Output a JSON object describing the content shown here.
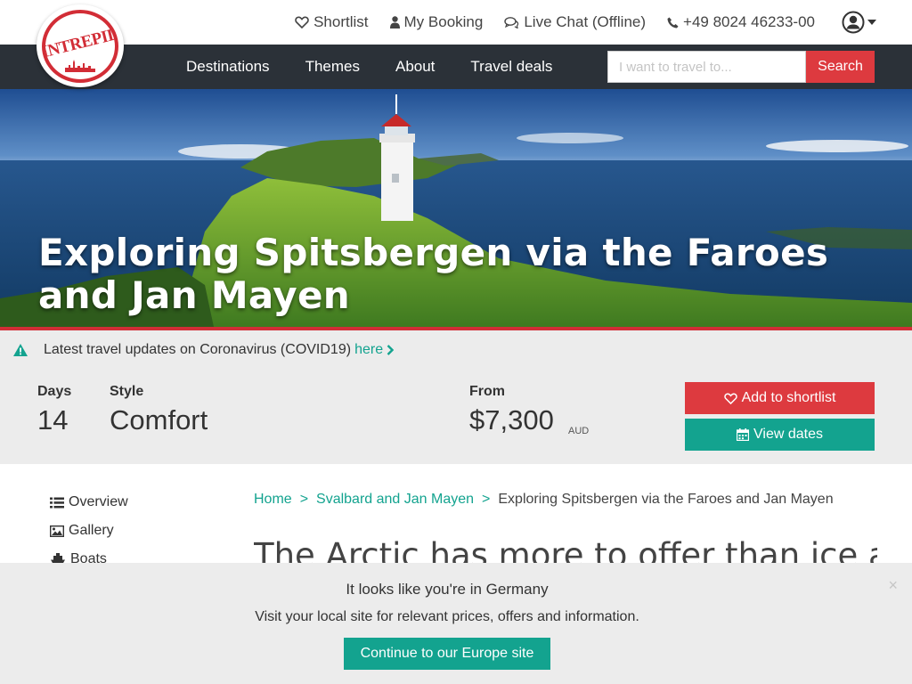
{
  "brand": {
    "logo_text": "INTREPID",
    "red": "#dd3a3f",
    "teal": "#13a38f",
    "nav_bg": "#2b3138"
  },
  "utility": {
    "shortlist": "Shortlist",
    "my_booking": "My Booking",
    "live_chat": "Live Chat (Offline)",
    "phone": "+49 8024 46233-00"
  },
  "nav": {
    "items": [
      "Destinations",
      "Themes",
      "About",
      "Travel deals"
    ],
    "search_placeholder": "I want to travel to...",
    "search_button": "Search"
  },
  "hero": {
    "title": "Exploring Spitsbergen via the Faroes and Jan Mayen"
  },
  "notice": {
    "text": "Latest travel updates on Coronavirus (COVID19)",
    "link": "here"
  },
  "trip": {
    "days_label": "Days",
    "days_value": "14",
    "style_label": "Style",
    "style_value": "Comfort",
    "from_label": "From",
    "price": "$7,300",
    "currency": "AUD",
    "shortlist_button": "Add to shortlist",
    "dates_button": "View dates"
  },
  "sidebar": {
    "items": [
      "Overview",
      "Gallery",
      "Boats"
    ]
  },
  "breadcrumb": {
    "home": "Home",
    "separator": ">",
    "parent": "Svalbard and Jan Mayen",
    "current": "Exploring Spitsbergen via the Faroes and Jan Mayen"
  },
  "intro": {
    "heading": "The Arctic has more to offer than ice and"
  },
  "geo_banner": {
    "title": "It looks like you're in Germany",
    "subtitle": "Visit your local site for relevant prices, offers and information.",
    "button": "Continue to our Europe site",
    "close": "×"
  }
}
